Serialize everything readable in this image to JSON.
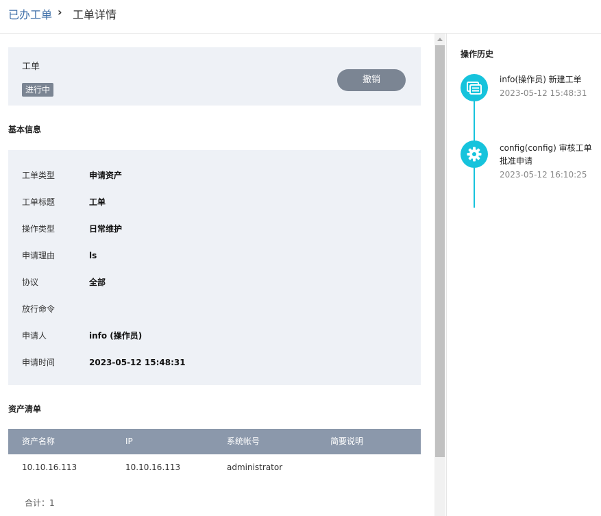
{
  "breadcrumb": {
    "parent": "已办工单",
    "separator": "›",
    "current": "工单详情"
  },
  "ticket": {
    "title": "工单",
    "status": "进行中",
    "revoke_label": "撤销"
  },
  "basic_info": {
    "title": "基本信息",
    "rows": [
      {
        "label": "工单类型",
        "value": "申请资产"
      },
      {
        "label": "工单标题",
        "value": "工单"
      },
      {
        "label": "操作类型",
        "value": "日常维护"
      },
      {
        "label": "申请理由",
        "value": "ls"
      },
      {
        "label": "协议",
        "value": "全部"
      },
      {
        "label": "放行命令",
        "value": ""
      },
      {
        "label": "申请人",
        "value": "info (操作员)"
      },
      {
        "label": "申请时间",
        "value": "2023-05-12 15:48:31"
      }
    ]
  },
  "assets": {
    "title": "资产清单",
    "columns": [
      "资产名称",
      "IP",
      "系统帐号",
      "简要说明"
    ],
    "rows": [
      [
        "10.10.16.113",
        "10.10.16.113",
        "administrator",
        ""
      ]
    ],
    "total": "合计：1"
  },
  "history": {
    "title": "操作历史",
    "accent": "#16c3dc",
    "items": [
      {
        "icon": "message-icon",
        "text": "info(操作员) 新建工单",
        "time": "2023-05-12 15:48:31"
      },
      {
        "icon": "gear-icon",
        "text": "config(config) 审核工单 批准申请",
        "time": "2023-05-12 16:10:25"
      }
    ]
  }
}
